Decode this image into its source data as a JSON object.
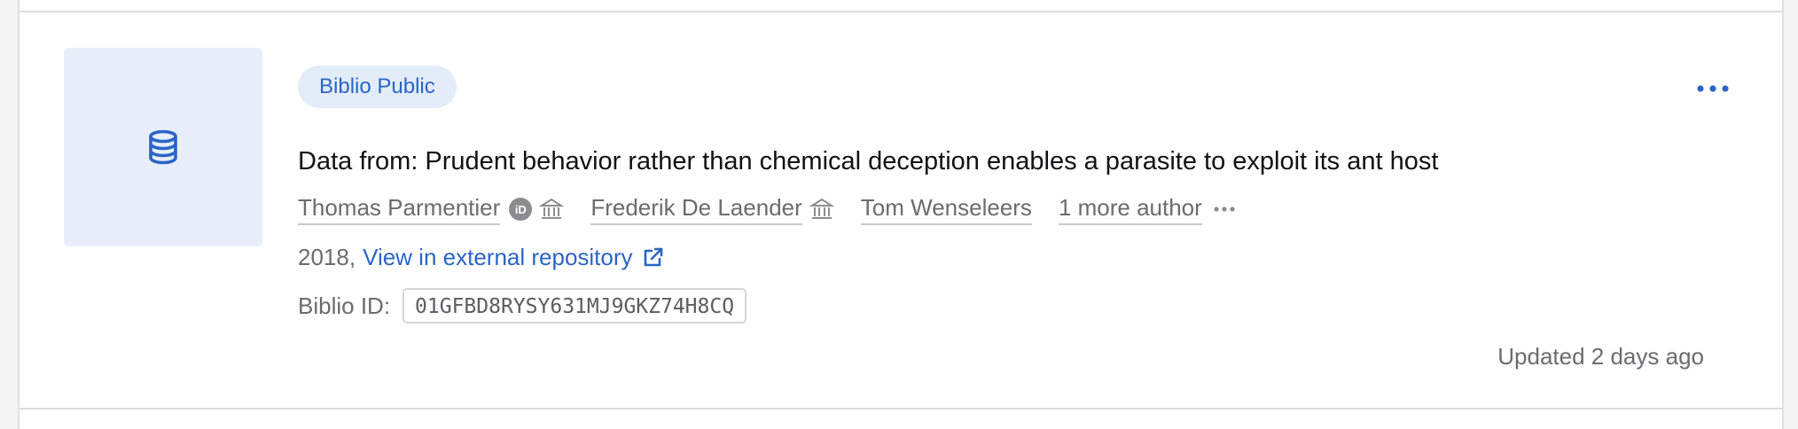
{
  "item": {
    "visibility_badge": "Biblio Public",
    "thumbnail_icon": "database-icon",
    "title": "Data from: Prudent behavior rather than chemical deception enables a parasite to exploit its ant host",
    "authors": [
      {
        "name": "Thomas Parmentier",
        "orcid_label": "iD",
        "icons": [
          "orcid-icon",
          "institution-icon"
        ]
      },
      {
        "name": "Frederik De Laender",
        "icons": [
          "institution-icon"
        ]
      },
      {
        "name": "Tom Wenseleers",
        "icons": []
      }
    ],
    "more_authors_label": "1 more author",
    "year": "2018,",
    "external_link_label": "View in external repository",
    "biblio_id_label": "Biblio ID:",
    "biblio_id_value": "01GFBD8RYSY631MJ9GKZ74H8CQ",
    "updated_text": "Updated 2 days ago"
  },
  "colors": {
    "accent": "#2b64c7",
    "badge_bg": "#e3ecf9",
    "thumbnail_bg": "#e7eef9",
    "muted_text": "#6b6b70",
    "title_text": "#121216"
  }
}
